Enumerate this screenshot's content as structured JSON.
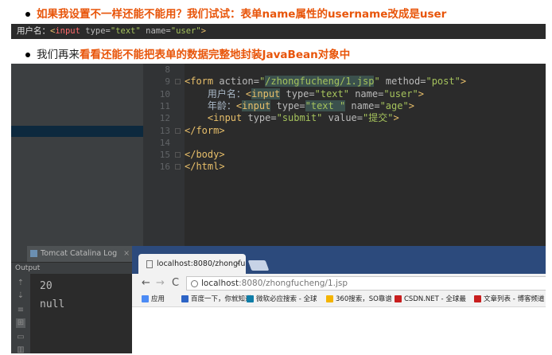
{
  "bullets": [
    {
      "plain": "",
      "bold": "如果我设置不一样还能不能用？我们试试：表单name属性的username改成是user"
    },
    {
      "plain": "我们再来",
      "bold": "看看还能不能把表单的数据完整地封装JavaBean对象中"
    }
  ],
  "snippet": {
    "label": "用户名：",
    "lt": "<",
    "tag": "input",
    "type_attr": "type=",
    "type_val": "\"text\"",
    "name_attr": "name=",
    "name_val": "\"user\"",
    "gt": ">"
  },
  "editor": {
    "line_numbers": [
      "8",
      "9",
      "10",
      "11",
      "12",
      "13",
      "14",
      "15",
      "16"
    ],
    "lines": [
      {
        "parts": []
      },
      {
        "parts": [
          {
            "t": "<form ",
            "c": "tag"
          },
          {
            "t": "action=",
            "c": "attr"
          },
          {
            "t": "\"",
            "c": "val"
          },
          {
            "t": "/zhongfucheng/1.jsp",
            "c": "valhl"
          },
          {
            "t": "\" ",
            "c": "val"
          },
          {
            "t": "method=",
            "c": "attr"
          },
          {
            "t": "\"post\"",
            "c": "val"
          },
          {
            "t": ">",
            "c": "tag"
          }
        ]
      },
      {
        "parts": [
          {
            "t": "    用户名：",
            "c": "txt"
          },
          {
            "t": "<",
            "c": "tag"
          },
          {
            "t": "input",
            "c": "taghl"
          },
          {
            "t": " type=",
            "c": "attr"
          },
          {
            "t": "\"text\" ",
            "c": "val"
          },
          {
            "t": "name=",
            "c": "attr"
          },
          {
            "t": "\"user\"",
            "c": "val"
          },
          {
            "t": ">",
            "c": "tag"
          }
        ]
      },
      {
        "parts": [
          {
            "t": "    年龄：",
            "c": "txt"
          },
          {
            "t": "<",
            "c": "tag"
          },
          {
            "t": "input",
            "c": "taghl"
          },
          {
            "t": " type=",
            "c": "attr"
          },
          {
            "t": "\"text \"",
            "c": "valhl"
          },
          {
            "t": " name=",
            "c": "attr"
          },
          {
            "t": "\"age\"",
            "c": "val"
          },
          {
            "t": ">",
            "c": "tag"
          }
        ]
      },
      {
        "parts": [
          {
            "t": "    <input ",
            "c": "tag"
          },
          {
            "t": "type=",
            "c": "attr"
          },
          {
            "t": "\"submit\" ",
            "c": "val"
          },
          {
            "t": "value=",
            "c": "attr"
          },
          {
            "t": "\"提交\"",
            "c": "val"
          },
          {
            "t": ">",
            "c": "tag"
          }
        ]
      },
      {
        "parts": [
          {
            "t": "</form>",
            "c": "tag"
          }
        ]
      },
      {
        "parts": []
      },
      {
        "parts": [
          {
            "t": "</body>",
            "c": "tag"
          }
        ]
      },
      {
        "parts": [
          {
            "t": "</html>",
            "c": "tag"
          }
        ]
      }
    ]
  },
  "tool_window": {
    "tab_label": "Tomcat Catalina Log",
    "tab_close": "×",
    "section_label": "Output",
    "output_lines": [
      "20",
      "null"
    ]
  },
  "browser": {
    "tab_title": "localhost:8080/zhongfu",
    "tab_close": "×",
    "url_host": "localhost",
    "url_rest": ":8080/zhongfucheng/1.jsp",
    "nav": {
      "back": "←",
      "forward": "→",
      "reload": "C"
    },
    "bookmarks": [
      {
        "label": "应用",
        "color": "#4c8bf5"
      },
      {
        "label": "百度一下，你就知道",
        "color": "#2d64c6"
      },
      {
        "label": "微软必应搜索 - 全球",
        "color": "#0f7ea8"
      },
      {
        "label": "360搜索，SO靠谱",
        "color": "#f4b400"
      },
      {
        "label": "CSDN.NET - 全球最",
        "color": "#c81e1e"
      },
      {
        "label": "文章列表 - 博客频道",
        "color": "#c81e1e"
      }
    ]
  },
  "colors": {
    "accent_orange": "#e8550a",
    "ide_bg": "#2b2b2b",
    "chrome_blue": "#2c4a7c"
  }
}
